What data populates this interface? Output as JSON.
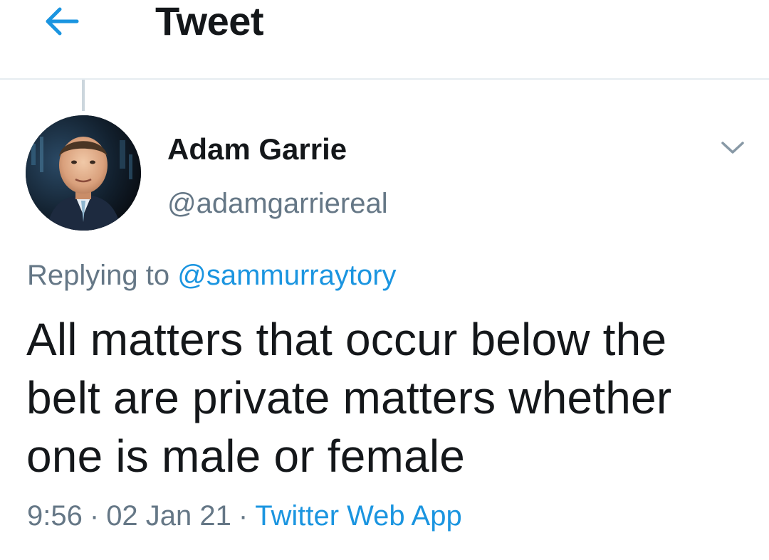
{
  "header": {
    "back_icon": "arrow-left-icon",
    "title": "Tweet"
  },
  "tweet": {
    "avatar_icon": "profile-photo",
    "display_name": "Adam Garrie",
    "handle": "@adamgarriereal",
    "more_icon": "chevron-down-icon",
    "replying_prefix": "Replying to",
    "replying_to": "@sammurraytory",
    "text_lines": [
      "All matters that occur below the",
      "belt are private matters whether",
      "one is male or female"
    ],
    "time": "9:56",
    "date": "02 Jan 21",
    "separator": "·",
    "source": "Twitter Web App"
  },
  "colors": {
    "accent": "#1b95e0",
    "text_primary": "#14171a",
    "text_secondary": "#657786",
    "divider": "#e6ecf0",
    "thread_line": "#ccd6dd"
  }
}
